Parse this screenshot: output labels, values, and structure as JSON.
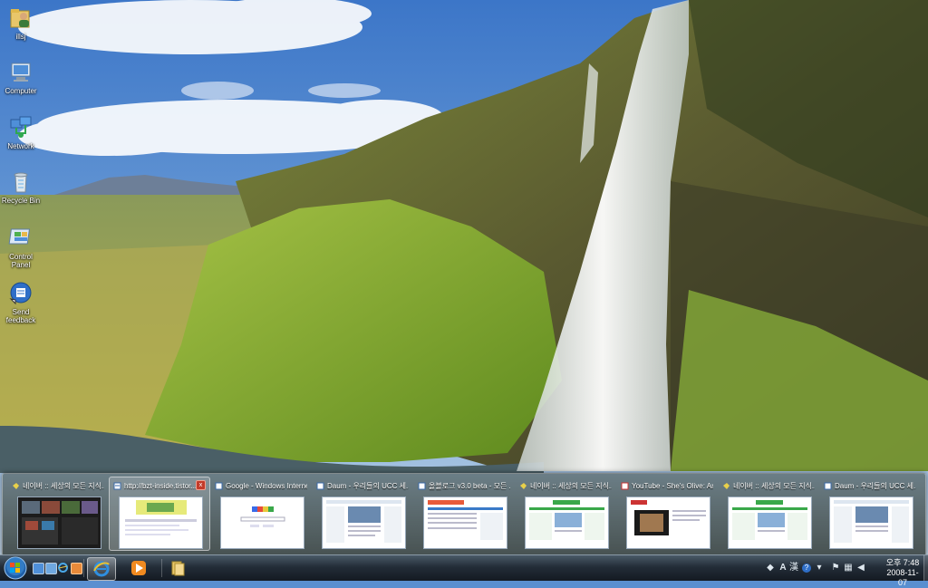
{
  "desktop": {
    "icons": [
      {
        "label": "illsj",
        "icon": "user-folder-icon"
      },
      {
        "label": "Computer",
        "icon": "computer-icon"
      },
      {
        "label": "Network",
        "icon": "network-icon"
      },
      {
        "label": "Recycle Bin",
        "icon": "recycle-bin-icon"
      },
      {
        "label": "Control Panel",
        "icon": "control-panel-icon"
      },
      {
        "label": "Send feedback",
        "icon": "send-feedback-icon"
      }
    ]
  },
  "thumbnails": [
    {
      "title": "네이버 :: 세상의 모든 지식...",
      "icon": "naver-favicon",
      "active": false
    },
    {
      "title": "http://bzt-inside.tistor...",
      "icon": "ie-page-icon",
      "active": true,
      "close_label": "x"
    },
    {
      "title": "Google - Windows Interne...",
      "icon": "ie-page-icon",
      "active": false
    },
    {
      "title": "Daum - 우리들의 UCC 세...",
      "icon": "ie-page-icon",
      "active": false
    },
    {
      "title": "올블로그 v3.0 beta - 모든 ...",
      "icon": "ie-page-icon",
      "active": false
    },
    {
      "title": "네이버 :: 세상의 모든 지식...",
      "icon": "naver-favicon",
      "active": false
    },
    {
      "title": "YouTube - She's Olive: Ar...",
      "icon": "youtube-favicon",
      "active": false
    },
    {
      "title": "네이버 :: 세상의 모든 지식...",
      "icon": "naver-favicon",
      "active": false
    },
    {
      "title": "Daum - 우리들의 UCC 세...",
      "icon": "ie-page-icon",
      "active": false
    }
  ],
  "taskbar": {
    "start_icon": "windows-start-orb",
    "quick_launch": [
      "show-desktop-icon",
      "switch-windows-icon",
      "ie-quick-icon",
      "media-player-quick-icon"
    ],
    "buttons": [
      "internet-explorer-icon",
      "windows-media-player-icon",
      "windows-explorer-icon"
    ],
    "tray": {
      "ime": "A",
      "ime_han": "漢",
      "help": "?",
      "clock_time": "오후 7:48",
      "clock_date": "2008-11-07"
    }
  },
  "colors": {
    "taskbar_top": "#4a5a68",
    "taskbar_bottom": "#141a22",
    "close_red": "#c23b2a"
  }
}
